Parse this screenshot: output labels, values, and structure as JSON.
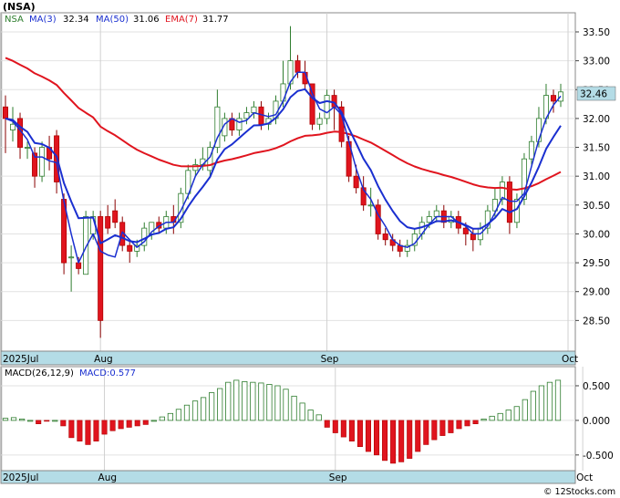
{
  "title": "(NSA)",
  "watermark": "© 12Stocks.com",
  "colors": {
    "up": "#2e7d2e",
    "down": "#e0141e",
    "ma3": "#1a2fd0",
    "ma50": "#1a2fd0",
    "ema7": "#e0141e",
    "date_band": "#b4dce6",
    "last_price_bg": "#b4dce6"
  },
  "chart_data": [
    {
      "type": "candlestick",
      "title": "(NSA)",
      "legend": [
        {
          "name": "NSA",
          "color": "#2e7d2e"
        },
        {
          "name": "MA(3)",
          "value": "32.34",
          "color": "#1a2fd0"
        },
        {
          "name": "MA(50)",
          "value": "31.06",
          "color": "#1a2fd0"
        },
        {
          "name": "EMA(7)",
          "value": "31.77",
          "color": "#e0141e"
        }
      ],
      "x_labels": [
        {
          "label": "2025Jul",
          "index": 0
        },
        {
          "label": "Aug",
          "index": 13
        },
        {
          "label": "Sep",
          "index": 44
        },
        {
          "label": "Oct",
          "index": 77
        }
      ],
      "ylim": [
        28.0,
        33.8
      ],
      "yticks": [
        "28.50",
        "29.00",
        "29.50",
        "30.00",
        "30.50",
        "31.00",
        "31.50",
        "32.00",
        "32.50",
        "33.00",
        "33.50"
      ],
      "last_price": "32.46",
      "candles": [
        [
          32.2,
          32.0,
          32.4,
          31.4
        ],
        [
          31.8,
          31.9,
          32.2,
          31.6
        ],
        [
          32.0,
          31.5,
          32.1,
          31.3
        ],
        [
          31.5,
          31.5,
          31.6,
          31.3
        ],
        [
          31.4,
          31.0,
          31.5,
          30.8
        ],
        [
          31.0,
          31.5,
          31.6,
          30.9
        ],
        [
          31.5,
          31.3,
          31.7,
          31.1
        ],
        [
          31.7,
          30.9,
          31.8,
          30.7
        ],
        [
          30.6,
          29.5,
          30.7,
          29.3
        ],
        [
          29.6,
          29.6,
          29.8,
          29.0
        ],
        [
          29.5,
          29.4,
          29.6,
          29.3
        ],
        [
          29.3,
          30.3,
          30.4,
          29.3
        ],
        [
          30.0,
          30.3,
          30.4,
          29.9
        ],
        [
          30.3,
          28.5,
          30.4,
          28.2
        ],
        [
          30.3,
          30.1,
          30.5,
          30.0
        ],
        [
          30.4,
          30.2,
          30.6,
          30.1
        ],
        [
          30.2,
          29.8,
          30.3,
          29.7
        ],
        [
          29.8,
          29.7,
          29.9,
          29.5
        ],
        [
          29.7,
          29.8,
          29.9,
          29.6
        ],
        [
          29.8,
          30.1,
          30.2,
          29.7
        ],
        [
          30.0,
          30.2,
          30.2,
          29.9
        ],
        [
          30.2,
          30.1,
          30.3,
          30.0
        ],
        [
          30.1,
          30.3,
          30.4,
          30.0
        ],
        [
          30.3,
          30.2,
          30.5,
          30.0
        ],
        [
          30.2,
          30.7,
          30.8,
          30.1
        ],
        [
          30.7,
          31.1,
          31.2,
          30.6
        ],
        [
          31.1,
          31.2,
          31.3,
          31.0
        ],
        [
          31.2,
          31.3,
          31.5,
          31.1
        ],
        [
          31.1,
          31.5,
          31.6,
          31.0
        ],
        [
          31.5,
          32.2,
          32.5,
          31.4
        ],
        [
          31.7,
          32.0,
          32.1,
          31.6
        ],
        [
          32.0,
          31.8,
          32.1,
          31.7
        ],
        [
          31.8,
          32.0,
          32.1,
          31.7
        ],
        [
          32.0,
          32.1,
          32.2,
          31.9
        ],
        [
          32.1,
          32.2,
          32.3,
          32.0
        ],
        [
          32.2,
          31.9,
          32.3,
          31.8
        ],
        [
          31.9,
          32.0,
          32.1,
          31.8
        ],
        [
          32.0,
          32.3,
          32.4,
          31.9
        ],
        [
          32.3,
          32.6,
          33.0,
          32.2
        ],
        [
          32.6,
          33.0,
          33.6,
          32.5
        ],
        [
          33.0,
          32.8,
          33.1,
          32.7
        ],
        [
          32.8,
          32.6,
          33.0,
          32.5
        ],
        [
          32.6,
          31.9,
          32.6,
          31.8
        ],
        [
          31.9,
          32.0,
          32.1,
          31.8
        ],
        [
          32.0,
          32.4,
          32.5,
          31.9
        ],
        [
          32.4,
          32.2,
          32.5,
          31.8
        ],
        [
          32.2,
          31.6,
          32.3,
          31.5
        ],
        [
          31.6,
          31.0,
          31.7,
          30.9
        ],
        [
          31.0,
          30.8,
          31.2,
          30.7
        ],
        [
          30.8,
          30.5,
          31.0,
          30.4
        ],
        [
          30.5,
          30.5,
          30.8,
          30.3
        ],
        [
          30.5,
          30.0,
          30.6,
          29.9
        ],
        [
          30.0,
          29.9,
          30.1,
          29.8
        ],
        [
          29.9,
          29.8,
          30.0,
          29.7
        ],
        [
          29.8,
          29.7,
          29.9,
          29.6
        ],
        [
          29.7,
          29.8,
          29.9,
          29.6
        ],
        [
          29.8,
          30.0,
          30.1,
          29.7
        ],
        [
          30.0,
          30.2,
          30.3,
          29.9
        ],
        [
          30.2,
          30.3,
          30.4,
          30.1
        ],
        [
          30.3,
          30.4,
          30.5,
          30.2
        ],
        [
          30.4,
          30.2,
          30.5,
          30.1
        ],
        [
          30.2,
          30.3,
          30.4,
          30.1
        ],
        [
          30.3,
          30.1,
          30.4,
          30.0
        ],
        [
          30.1,
          30.0,
          30.2,
          29.8
        ],
        [
          30.0,
          29.9,
          30.1,
          29.7
        ],
        [
          29.9,
          30.1,
          30.2,
          29.8
        ],
        [
          30.1,
          30.4,
          30.5,
          30.0
        ],
        [
          30.4,
          30.6,
          30.8,
          30.3
        ],
        [
          30.6,
          30.9,
          31.0,
          30.5
        ],
        [
          30.9,
          30.2,
          31.0,
          30.0
        ],
        [
          30.2,
          30.6,
          30.7,
          30.1
        ],
        [
          30.6,
          31.3,
          31.4,
          30.5
        ],
        [
          31.3,
          31.6,
          31.7,
          31.2
        ],
        [
          31.6,
          32.0,
          32.2,
          31.5
        ],
        [
          32.0,
          32.4,
          32.6,
          31.9
        ],
        [
          32.4,
          32.3,
          32.5,
          32.1
        ],
        [
          32.3,
          32.46,
          32.6,
          32.2
        ]
      ]
    },
    {
      "type": "bar",
      "title": "MACD(26,12,9)",
      "legend": [
        {
          "name": "MACD(26,12,9)",
          "color": "#000000"
        },
        {
          "name": "MACD:0.577",
          "color": "#1a2fd0"
        }
      ],
      "ylim": [
        -0.7,
        0.75
      ],
      "yticks": [
        "0.500",
        "0.000",
        "-0.500"
      ],
      "values": [
        0.03,
        0.04,
        0.02,
        0.0,
        -0.05,
        -0.01,
        0.0,
        -0.08,
        -0.25,
        -0.3,
        -0.35,
        -0.3,
        -0.2,
        -0.15,
        -0.12,
        -0.1,
        -0.08,
        -0.06,
        0.0,
        0.05,
        0.1,
        0.16,
        0.22,
        0.28,
        0.33,
        0.4,
        0.46,
        0.55,
        0.58,
        0.56,
        0.55,
        0.54,
        0.52,
        0.5,
        0.45,
        0.35,
        0.25,
        0.15,
        0.08,
        -0.1,
        -0.18,
        -0.24,
        -0.3,
        -0.38,
        -0.45,
        -0.5,
        -0.58,
        -0.62,
        -0.6,
        -0.55,
        -0.45,
        -0.35,
        -0.28,
        -0.22,
        -0.18,
        -0.12,
        -0.08,
        -0.05,
        0.02,
        0.06,
        0.1,
        0.15,
        0.2,
        0.3,
        0.42,
        0.5,
        0.55,
        0.58
      ]
    }
  ],
  "macd_x_labels": [
    {
      "label": "2025Jul",
      "index": 0
    },
    {
      "label": "Aug",
      "index": 12
    },
    {
      "label": "Sep",
      "index": 40
    },
    {
      "label": "Oct",
      "index": 70
    }
  ]
}
